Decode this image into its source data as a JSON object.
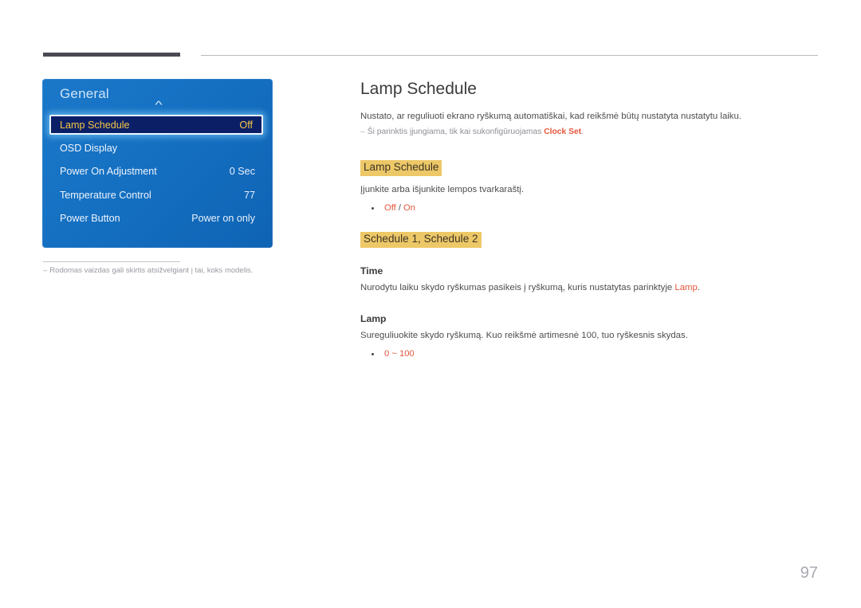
{
  "osd": {
    "title": "General",
    "chevron_icon": "chevron-up-icon",
    "rows": [
      {
        "label": "Lamp Schedule",
        "value": "Off",
        "selected": true
      },
      {
        "label": "OSD Display",
        "value": "",
        "selected": false
      },
      {
        "label": "Power On Adjustment",
        "value": "0 Sec",
        "selected": false
      },
      {
        "label": "Temperature Control",
        "value": "77",
        "selected": false
      },
      {
        "label": "Power Button",
        "value": "Power on only",
        "selected": false
      }
    ]
  },
  "footnote": {
    "dash": "‒",
    "text": "Rodomas vaizdas gali skirtis atsižvelgiant į tai, koks modelis."
  },
  "content": {
    "title": "Lamp Schedule",
    "intro": "Nustato, ar reguliuoti ekrano ryškumą automatiškai, kad reikšmė būtų nustatyta nustatytu laiku.",
    "note": {
      "dash": "‒",
      "before": "Ši parinktis įjungiama, tik kai sukonfigūruojamas ",
      "link": "Clock Set",
      "after": "."
    },
    "section1": {
      "heading": "Lamp Schedule",
      "paragraph": "Įjunkite arba išjunkite lempos tvarkaraštį.",
      "bullet_first": "Off",
      "bullet_sep": " / ",
      "bullet_second": "On"
    },
    "section2": {
      "heading": "Schedule 1, Schedule 2",
      "time": {
        "heading": "Time",
        "before": "Nurodytu laiku skydo ryškumas pasikeis į ryškumą, kuris nustatytas parinktyje ",
        "link": "Lamp",
        "after": "."
      },
      "lamp": {
        "heading": "Lamp",
        "paragraph": "Sureguliuokite skydo ryškumą. Kuo reikšmė artimesnė 100, tuo ryškesnis skydas.",
        "bullet": "0 ~ 100"
      }
    }
  },
  "page_number": "97",
  "colors": {
    "accent": "#e4573c",
    "highlight": "#edc867",
    "osd_panel": "#1570c2",
    "osd_selected_bg": "#0b1f67",
    "osd_selected_text": "#f5c842",
    "rule_dark": "#4a4a55"
  }
}
